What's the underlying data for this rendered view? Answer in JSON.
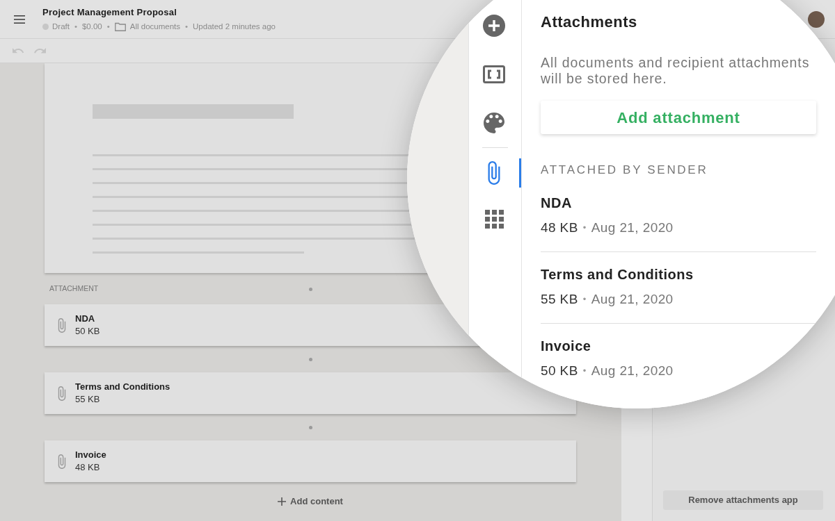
{
  "header": {
    "title": "Project Management Proposal",
    "meta": [
      {
        "kind": "status",
        "text": "Draft"
      },
      {
        "kind": "separator",
        "text": "•"
      },
      {
        "kind": "text",
        "text": "$0.00"
      },
      {
        "kind": "separator",
        "text": "•"
      },
      {
        "kind": "folder",
        "text": "All documents"
      },
      {
        "kind": "separator",
        "text": "•"
      },
      {
        "kind": "text",
        "text": "Updated 2 minutes ago"
      }
    ]
  },
  "toolbar": {
    "undo": {
      "disabled": true
    },
    "redo": {
      "disabled": true
    }
  },
  "attachments": {
    "label": "ATTACHMENT",
    "items": [
      {
        "name": "NDA",
        "size": "50 KB"
      },
      {
        "name": "Terms and Conditions",
        "size": "55 KB"
      },
      {
        "name": "Invoice",
        "size": "48 KB"
      }
    ],
    "add_content": "Add content"
  },
  "app_panel": {
    "remove_button": "Remove attachments app"
  },
  "magnifier": {
    "rail": {
      "tools": [
        {
          "kind": "add",
          "selected": false
        },
        {
          "kind": "frame",
          "selected": false
        },
        {
          "kind": "palette",
          "selected": false
        }
      ],
      "apps": [
        {
          "kind": "attachments",
          "selected": true
        },
        {
          "kind": "apps",
          "selected": false
        }
      ]
    },
    "panel": {
      "title": "Attachments",
      "description": "All documents and recipient attachments will be stored here.",
      "add_button": "Add attachment",
      "section_label": "ATTACHED BY SENDER",
      "files": [
        {
          "name": "NDA",
          "size": "48 KB",
          "separator": "•",
          "date": "Aug 21, 2020"
        },
        {
          "name": "Terms and Conditions",
          "size": "55 KB",
          "separator": "•",
          "date": "Aug 21, 2020"
        },
        {
          "name": "Invoice",
          "size": "50 KB",
          "separator": "•",
          "date": "Aug 21, 2020"
        }
      ]
    }
  }
}
